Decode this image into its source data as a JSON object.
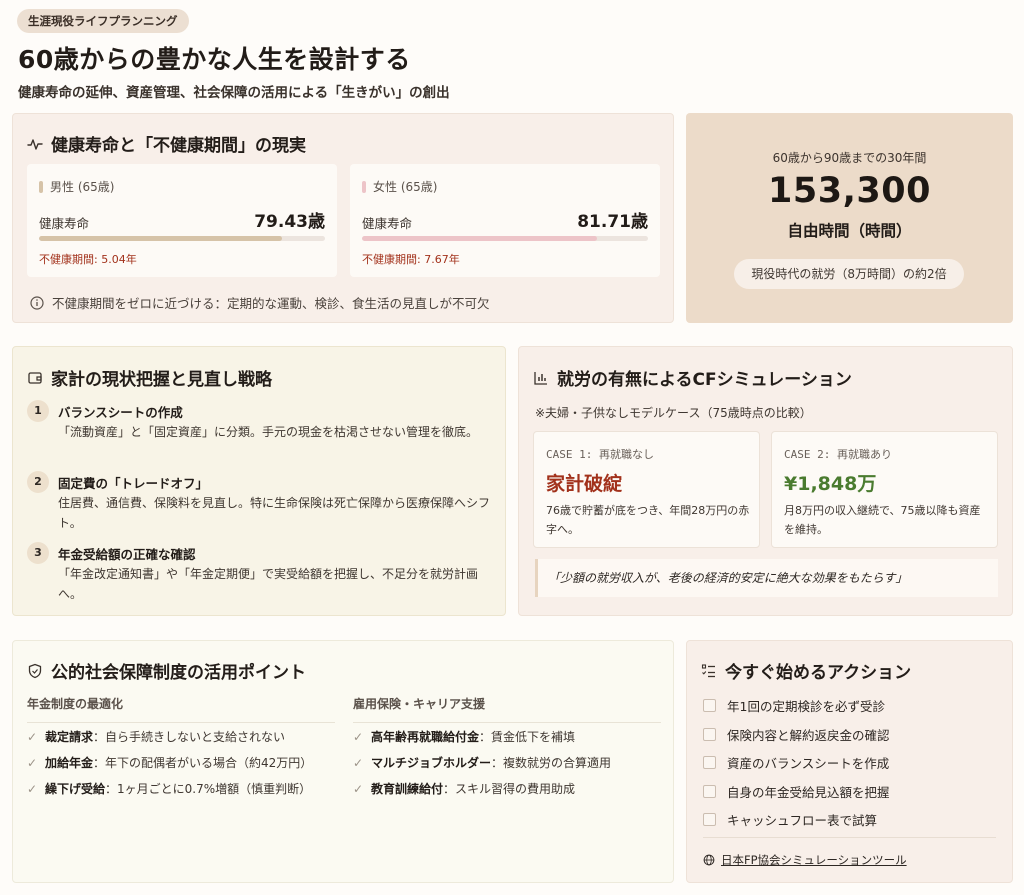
{
  "header": {
    "badge": "生涯現役ライフプランニング",
    "title": "60歳からの豊かな人生を設計する",
    "subtitle": "健康寿命の延伸、資産管理、社会保障の活用による「生きがい」の創出"
  },
  "health": {
    "title": "健康寿命と「不健康期間」の現実",
    "icon": "pulse-icon",
    "male": {
      "header": "男性 (65歳)",
      "label": "健康寿命",
      "value": "79.43歳",
      "bar_fraction": 0.85,
      "unhealthy": "不健康期間: 5.04年",
      "color": "#d6c3a8"
    },
    "female": {
      "header": "女性 (65歳)",
      "label": "健康寿命",
      "value": "81.71歳",
      "bar_fraction": 0.82,
      "unhealthy": "不健康期間: 7.67年",
      "color": "#edc4c8"
    },
    "note": "不健康期間をゼロに近づける：定期的な運動、検診、食生活の見直しが不可欠"
  },
  "free_time": {
    "caption": "60歳から90歳までの30年間",
    "number": "153,300",
    "unit": "自由時間（時間）",
    "pill": "現役時代の就労（8万時間）の約2倍"
  },
  "budget": {
    "title": "家計の現状把握と見直し戦略",
    "icon": "wallet-icon",
    "steps": [
      {
        "num": "1",
        "title": "バランスシートの作成",
        "desc": "「流動資産」と「固定資産」に分類。手元の現金を枯渇させない管理を徹底。"
      },
      {
        "num": "2",
        "title": "固定費の「トレードオフ」",
        "desc": "住居費、通信費、保険料を見直し。特に生命保険は死亡保障から医療保障へシフト。"
      },
      {
        "num": "3",
        "title": "年金受給額の正確な確認",
        "desc": "「年金改定通知書」や「年金定期便」で実受給額を把握し、不足分を就労計画へ。"
      }
    ]
  },
  "cf": {
    "title": "就労の有無によるCFシミュレーション",
    "icon": "bar-chart-icon",
    "subtitle": "※夫婦・子供なしモデルケース（75歳時点の比較）",
    "case1": {
      "label": "CASE 1: 再就職なし",
      "big": "家計破綻",
      "desc": "76歳で貯蓄が底をつき、年間28万円の赤字へ。",
      "color": "#a2311b"
    },
    "case2": {
      "label": "CASE 2: 再就職あり",
      "big": "¥1,848万",
      "desc": "月8万円の収入継続で、75歳以降も資産を維持。",
      "color": "#4a7b2f"
    },
    "quote": "「少額の就労収入が、老後の経済的安定に絶大な効果をもたらす」"
  },
  "social": {
    "title": "公的社会保障制度の活用ポイント",
    "icon": "shield-icon",
    "left_head": "年金制度の最適化",
    "right_head": "雇用保険・キャリア支援",
    "left_items": [
      {
        "bold": "裁定請求",
        "text": "：自ら手続きしないと支給されない"
      },
      {
        "bold": "加給年金",
        "text": "：年下の配偶者がいる場合（約42万円）"
      },
      {
        "bold": "繰下げ受給",
        "text": "：1ヶ月ごとに0.7%増額（慎重判断）"
      }
    ],
    "right_items": [
      {
        "bold": "高年齢再就職給付金",
        "text": "：賃金低下を補填"
      },
      {
        "bold": "マルチジョブホルダー",
        "text": "：複数就労の合算適用"
      },
      {
        "bold": "教育訓練給付",
        "text": "：スキル習得の費用助成"
      }
    ]
  },
  "action": {
    "title": "今すぐ始めるアクション",
    "icon": "checklist-icon",
    "items": [
      "年1回の定期検診を必ず受診",
      "保険内容と解約返戻金の確認",
      "資産のバランスシートを作成",
      "自身の年金受給見込額を把握",
      "キャッシュフロー表で試算"
    ],
    "link": "日本FP協会シミュレーションツール",
    "link_icon": "globe-icon"
  }
}
